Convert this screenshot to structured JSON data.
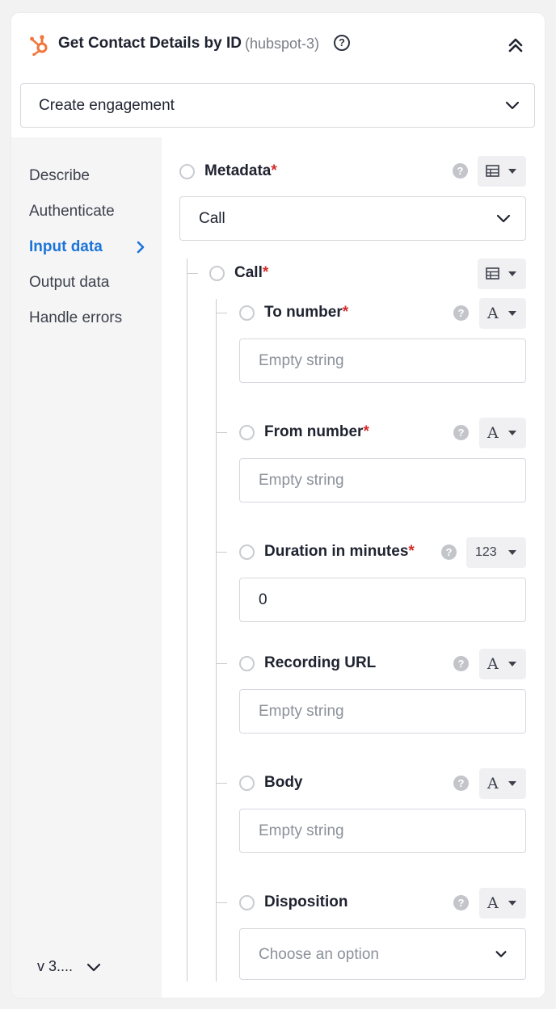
{
  "header": {
    "title": "Get Contact Details by ID",
    "subtitle": "(hubspot-3)",
    "help_glyph": "?",
    "logo_icon": "hubspot-logo-icon",
    "collapse_icon": "double-chevron-up-icon"
  },
  "action": {
    "value": "Create engagement"
  },
  "sidebar": {
    "items": [
      {
        "label": "Describe"
      },
      {
        "label": "Authenticate"
      },
      {
        "label": "Input data"
      },
      {
        "label": "Output data"
      },
      {
        "label": "Handle errors"
      }
    ],
    "active_index": 2,
    "version": "v 3...."
  },
  "metadata": {
    "label": "Metadata",
    "required_mark": "*",
    "value": "Call"
  },
  "call": {
    "label": "Call",
    "required_mark": "*"
  },
  "fields": [
    {
      "label": "To number",
      "required_mark": "*",
      "type_glyph": "A",
      "placeholder": "Empty string",
      "value": ""
    },
    {
      "label": "From number",
      "required_mark": "*",
      "type_glyph": "A",
      "placeholder": "Empty string",
      "value": ""
    },
    {
      "label": "Duration in minutes",
      "required_mark": "*",
      "type_glyph": "123",
      "placeholder": "",
      "value": "0"
    },
    {
      "label": "Recording URL",
      "required_mark": "",
      "type_glyph": "A",
      "placeholder": "Empty string",
      "value": ""
    },
    {
      "label": "Body",
      "required_mark": "",
      "type_glyph": "A",
      "placeholder": "Empty string",
      "value": ""
    },
    {
      "label": "Disposition",
      "required_mark": "",
      "type_glyph": "A",
      "placeholder": "Choose an option",
      "value": ""
    }
  ],
  "help_badge": "?",
  "colors": {
    "accent": "#1b74d9",
    "required": "#d62b2b",
    "hubspot": "#f0763c"
  }
}
